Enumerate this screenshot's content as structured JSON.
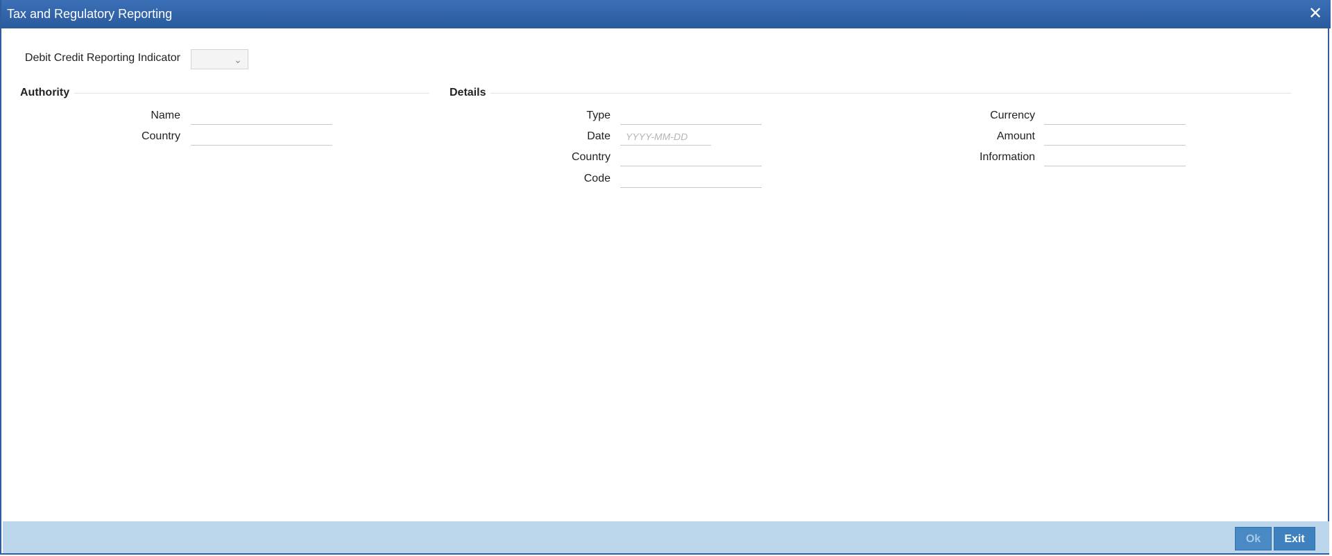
{
  "window": {
    "title": "Tax and Regulatory Reporting",
    "close_icon": "close-icon"
  },
  "top": {
    "debit_credit_label": "Debit Credit Reporting Indicator",
    "debit_credit_value": ""
  },
  "authority": {
    "title": "Authority",
    "name_label": "Name",
    "name_value": "",
    "country_label": "Country",
    "country_value": ""
  },
  "details": {
    "title": "Details",
    "type_label": "Type",
    "type_value": "",
    "date_label": "Date",
    "date_placeholder": "YYYY-MM-DD",
    "country_label": "Country",
    "country_value": "",
    "code_label": "Code",
    "code_value": "",
    "currency_label": "Currency",
    "currency_value": "",
    "amount_label": "Amount",
    "amount_value": "",
    "information_label": "Information",
    "information_value": ""
  },
  "footer": {
    "ok_label": "Ok",
    "exit_label": "Exit"
  },
  "colors": {
    "titlebar": "#2a5a9e",
    "footer": "#bcd6ec",
    "button": "#3f81bf"
  }
}
